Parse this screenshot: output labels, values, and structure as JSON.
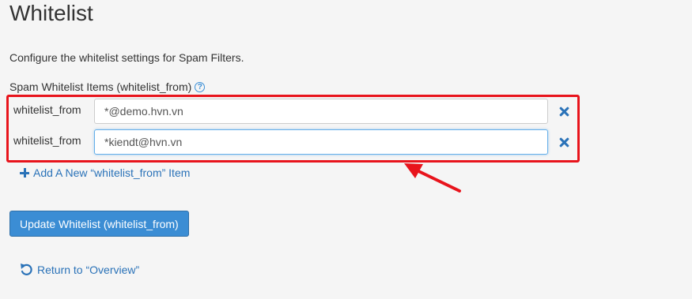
{
  "page": {
    "title": "Whitelist",
    "description": "Configure the whitelist settings for Spam Filters."
  },
  "section": {
    "label": "Spam Whitelist Items (whitelist_from)",
    "help_icon": "question-circle-icon"
  },
  "items": [
    {
      "label": "whitelist_from",
      "value": "*@demo.hvn.vn"
    },
    {
      "label": "whitelist_from",
      "value": "*kiendt@hvn.vn"
    }
  ],
  "actions": {
    "add_label": "Add A New “whitelist_from” Item",
    "update_label": "Update Whitelist (whitelist_from)",
    "return_label": "Return to “Overview”"
  },
  "colors": {
    "accent": "#2a72b8",
    "button": "#3b8dd4",
    "highlight": "#e8141c"
  }
}
